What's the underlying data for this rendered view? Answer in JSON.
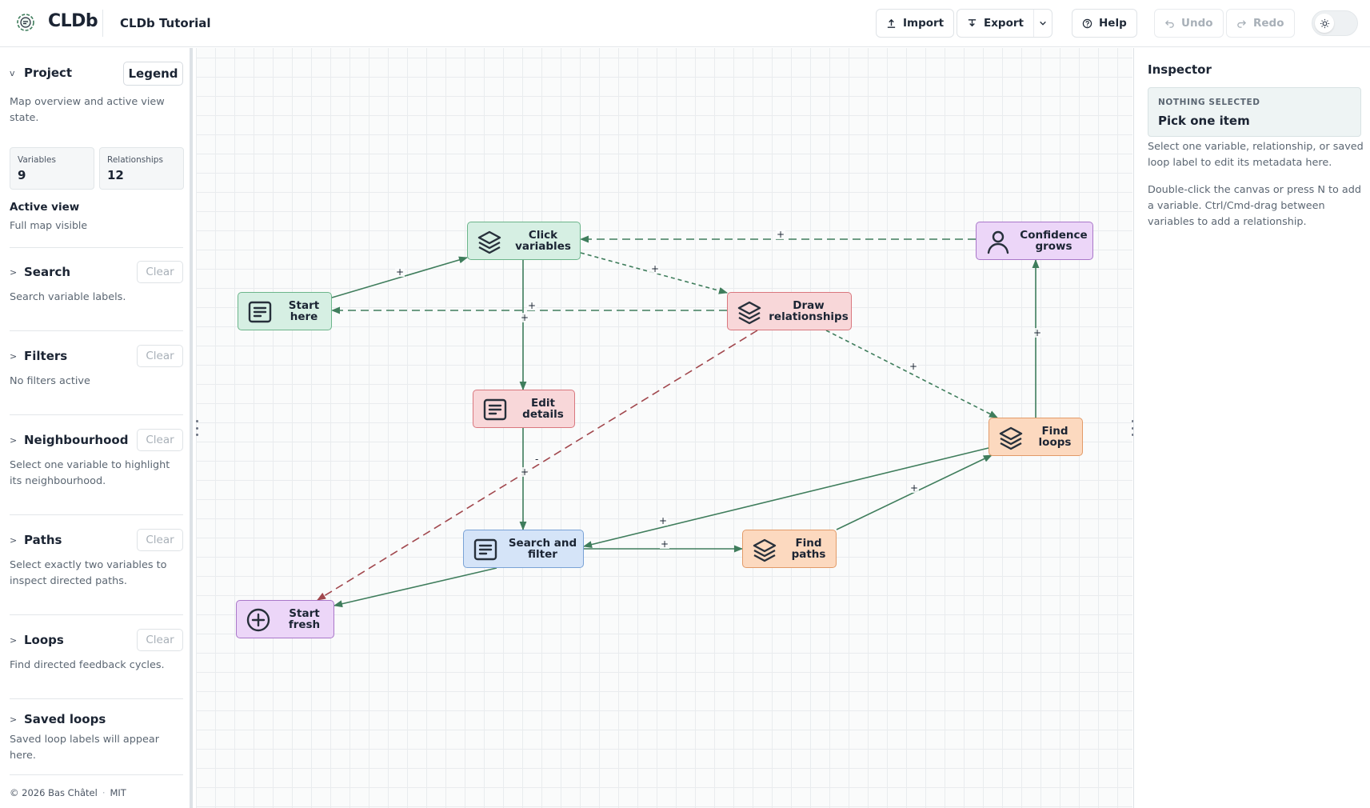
{
  "header": {
    "brand": "CLDb",
    "project_title": "CLDb Tutorial",
    "import_label": "Import",
    "export_label": "Export",
    "help_label": "Help",
    "undo_label": "Undo",
    "redo_label": "Redo"
  },
  "sidebar": {
    "project": {
      "title": "Project",
      "legend_label": "Legend",
      "description": "Map overview and active view state.",
      "stats": [
        {
          "label": "Variables",
          "value": "9"
        },
        {
          "label": "Relationships",
          "value": "12"
        }
      ],
      "active_view_title": "Active view",
      "active_view_value": "Full map visible"
    },
    "sections": [
      {
        "title": "Search",
        "clear": "Clear",
        "description": "Search variable labels."
      },
      {
        "title": "Filters",
        "clear": "Clear",
        "description": "No filters active"
      },
      {
        "title": "Neighbourhood",
        "clear": "Clear",
        "description": "Select one variable to highlight its neighbourhood."
      },
      {
        "title": "Paths",
        "clear": "Clear",
        "description": "Select exactly two variables to inspect directed paths."
      },
      {
        "title": "Loops",
        "clear": "Clear",
        "description": "Find directed feedback cycles."
      },
      {
        "title": "Saved loops",
        "clear": "",
        "description": "Saved loop labels will appear here."
      }
    ],
    "footer": {
      "copyright": "© 2026 Bas Châtel",
      "separator": "·",
      "license": "MIT"
    }
  },
  "nodes": [
    {
      "id": "start-here",
      "label": "Start here",
      "color": "green",
      "icon": "note-icon"
    },
    {
      "id": "click-variables",
      "label": "Click variables",
      "color": "green",
      "icon": "layers-icon"
    },
    {
      "id": "draw-relationships",
      "label": "Draw relationships",
      "color": "red",
      "icon": "layers-icon"
    },
    {
      "id": "confidence-grows",
      "label": "Confidence grows",
      "color": "purple",
      "icon": "person-icon"
    },
    {
      "id": "edit-details",
      "label": "Edit details",
      "color": "red",
      "icon": "note-icon"
    },
    {
      "id": "find-loops",
      "label": "Find loops",
      "color": "orange",
      "icon": "layers-icon"
    },
    {
      "id": "search-and-filter",
      "label": "Search and filter",
      "color": "blue",
      "icon": "note-icon"
    },
    {
      "id": "find-paths",
      "label": "Find paths",
      "color": "orange",
      "icon": "layers-icon"
    },
    {
      "id": "start-fresh",
      "label": "Start fresh",
      "color": "purple",
      "icon": "plus-circle-icon"
    }
  ],
  "edges": [
    {
      "from": "start-here",
      "to": "click-variables",
      "polarity": "+",
      "style": "solid"
    },
    {
      "from": "confidence-grows",
      "to": "click-variables",
      "polarity": "+",
      "style": "long-dash"
    },
    {
      "from": "click-variables",
      "to": "draw-relationships",
      "polarity": "+",
      "style": "short-dash"
    },
    {
      "from": "draw-relationships",
      "to": "start-here",
      "polarity": "+",
      "style": "long-dash"
    },
    {
      "from": "click-variables",
      "to": "edit-details",
      "polarity": "+",
      "style": "solid"
    },
    {
      "from": "draw-relationships",
      "to": "find-loops",
      "polarity": "+",
      "style": "short-dash"
    },
    {
      "from": "draw-relationships",
      "to": "start-fresh",
      "polarity": "-",
      "style": "long-dash"
    },
    {
      "from": "find-loops",
      "to": "confidence-grows",
      "polarity": "+",
      "style": "solid"
    },
    {
      "from": "edit-details",
      "to": "search-and-filter",
      "polarity": "+",
      "style": "solid"
    },
    {
      "from": "search-and-filter",
      "to": "find-paths",
      "polarity": "+",
      "style": "solid"
    },
    {
      "from": "find-paths",
      "to": "find-loops",
      "polarity": "+",
      "style": "solid"
    },
    {
      "from": "find-loops",
      "to": "search-and-filter",
      "polarity": "+",
      "style": "solid"
    },
    {
      "from": "search-and-filter",
      "to": "start-fresh",
      "polarity": "",
      "style": "solid"
    }
  ],
  "colors": {
    "positive_edge": "#3f7d5c",
    "negative_edge": "#a1474d"
  },
  "inspector": {
    "title": "Inspector",
    "eyebrow": "NOTHING SELECTED",
    "heading": "Pick one item",
    "text1": "Select one variable, relationship, or saved loop label to edit its metadata here.",
    "text2": "Double-click the canvas or press N to add a variable. Ctrl/Cmd-drag between variables to add a relationship."
  }
}
